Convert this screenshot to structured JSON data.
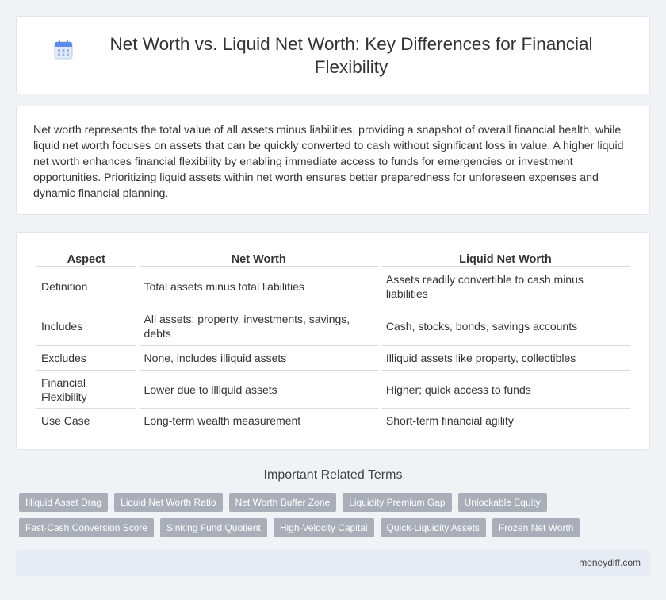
{
  "header": {
    "title": "Net Worth vs. Liquid Net Worth: Key Differences for Financial Flexibility",
    "icon": "calendar-icon"
  },
  "intro": {
    "text": "Net worth represents the total value of all assets minus liabilities, providing a snapshot of overall financial health, while liquid net worth focuses on assets that can be quickly converted to cash without significant loss in value. A higher liquid net worth enhances financial flexibility by enabling immediate access to funds for emergencies or investment opportunities. Prioritizing liquid assets within net worth ensures better preparedness for unforeseen expenses and dynamic financial planning."
  },
  "table": {
    "headers": [
      "Aspect",
      "Net Worth",
      "Liquid Net Worth"
    ],
    "rows": [
      [
        "Definition",
        "Total assets minus total liabilities",
        "Assets readily convertible to cash minus liabilities"
      ],
      [
        "Includes",
        "All assets: property, investments, savings, debts",
        "Cash, stocks, bonds, savings accounts"
      ],
      [
        "Excludes",
        "None, includes illiquid assets",
        "Illiquid assets like property, collectibles"
      ],
      [
        "Financial Flexibility",
        "Lower due to illiquid assets",
        "Higher; quick access to funds"
      ],
      [
        "Use Case",
        "Long-term wealth measurement",
        "Short-term financial agility"
      ]
    ]
  },
  "related": {
    "title": "Important Related Terms",
    "row1": [
      "Illiquid Asset Drag",
      "Liquid Net Worth Ratio",
      "Net Worth Buffer Zone",
      "Liquidity Premium Gap",
      "Unlockable Equity"
    ],
    "row2": [
      "Fast-Cash Conversion Score",
      "Sinking Fund Quotient",
      "High-Velocity Capital",
      "Quick-Liquidity Assets",
      "Frozen Net Worth"
    ]
  },
  "footer": {
    "site": "moneydiff.com"
  },
  "colors": {
    "background": "#f1f2f6",
    "tag": "#a9aeb8",
    "footer": "#e6ebf4",
    "icon_blue": "#5b8def"
  }
}
